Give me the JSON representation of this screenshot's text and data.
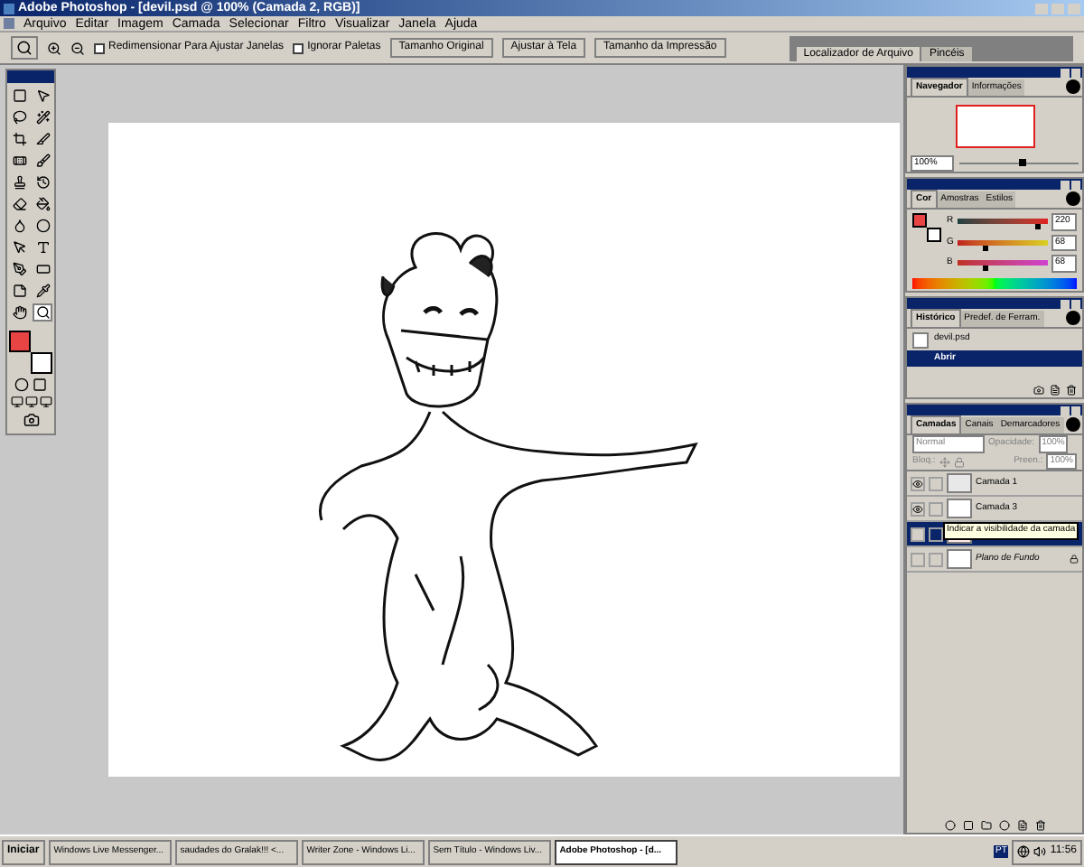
{
  "window": {
    "title": "Adobe Photoshop - [devil.psd @ 100% (Camada 2, RGB)]"
  },
  "menu": [
    "Arquivo",
    "Editar",
    "Imagem",
    "Camada",
    "Selecionar",
    "Filtro",
    "Visualizar",
    "Janela",
    "Ajuda"
  ],
  "options_bar": {
    "checkboxes": [
      {
        "label": "Redimensionar Para Ajustar Janelas",
        "checked": false
      },
      {
        "label": "Ignorar Paletas",
        "checked": false
      }
    ],
    "buttons": [
      "Tamanho Original",
      "Ajustar à Tela",
      "Tamanho da Impressão"
    ],
    "palette_well_tabs": [
      {
        "label": "Localizador de Arquivo",
        "selected": true
      },
      {
        "label": "Pincéis",
        "selected": false
      }
    ]
  },
  "toolbox": {
    "tools": [
      {
        "kind": "marquee",
        "selected": false
      },
      {
        "kind": "move",
        "selected": false
      },
      {
        "kind": "lasso",
        "selected": false
      },
      {
        "kind": "wand",
        "selected": false
      },
      {
        "kind": "crop",
        "selected": false
      },
      {
        "kind": "slice",
        "selected": false
      },
      {
        "kind": "heal",
        "selected": false
      },
      {
        "kind": "brush",
        "selected": false
      },
      {
        "kind": "stamp",
        "selected": false
      },
      {
        "kind": "history",
        "selected": false
      },
      {
        "kind": "eraser",
        "selected": false
      },
      {
        "kind": "bucket",
        "selected": false
      },
      {
        "kind": "blur",
        "selected": false
      },
      {
        "kind": "dodge",
        "selected": false
      },
      {
        "kind": "select",
        "selected": false
      },
      {
        "kind": "text",
        "selected": false
      },
      {
        "kind": "pen",
        "selected": false
      },
      {
        "kind": "shape",
        "selected": false
      },
      {
        "kind": "notes",
        "selected": false
      },
      {
        "kind": "eyedropper",
        "selected": false
      },
      {
        "kind": "hand",
        "selected": false
      },
      {
        "kind": "zoom",
        "selected": true
      }
    ],
    "swatches": [
      {
        "kind": "background",
        "color": "#ffffff"
      },
      {
        "kind": "foreground",
        "color": "#e84444"
      }
    ]
  },
  "navigator": {
    "tabs": [
      {
        "label": "Navegador",
        "selected": true
      },
      {
        "label": "Informações",
        "selected": false
      }
    ],
    "zoom": "100%",
    "level": 0.5
  },
  "color_panel": {
    "tabs": [
      {
        "label": "Cor",
        "selected": true
      },
      {
        "label": "Amostras",
        "selected": false
      },
      {
        "label": "Estilos",
        "selected": false
      }
    ],
    "swatches": [
      {
        "kind": "background",
        "color": "#ffffff"
      },
      {
        "kind": "foreground",
        "color": "#e84444"
      }
    ],
    "channels": [
      {
        "label": "R",
        "value": "220",
        "level": 0.86
      },
      {
        "label": "G",
        "value": "68",
        "level": 0.27
      },
      {
        "label": "B",
        "value": "68",
        "level": 0.27
      }
    ]
  },
  "history": {
    "tabs": [
      {
        "label": "Histórico",
        "selected": true
      },
      {
        "label": "Predef. de Ferram.",
        "selected": false
      }
    ],
    "snapshot": "devil.psd",
    "steps": [
      {
        "label": "Abrir",
        "selected": true
      }
    ]
  },
  "layers_panel": {
    "tabs": [
      {
        "label": "Camadas",
        "selected": true
      },
      {
        "label": "Canais",
        "selected": false
      },
      {
        "label": "Demarcadores",
        "selected": false
      }
    ],
    "blend_mode": "Normal",
    "opacity_label": "Opacidade:",
    "opacity": "100%",
    "lock_label": "Bloq.:",
    "fill_label": "Preen.:",
    "fill": "100%",
    "layers": [
      {
        "name": "Camada 1",
        "visible": true,
        "selected": false,
        "kind": "transparent"
      },
      {
        "name": "Camada 3",
        "visible": true,
        "selected": false,
        "kind": "white"
      },
      {
        "visible": false,
        "selected": true,
        "kind": "sketch"
      },
      {
        "name": "Plano de Fundo",
        "visible": false,
        "selected": false,
        "kind": "background"
      }
    ],
    "tooltip": "Indicar a visibilidade da camada"
  },
  "taskbar": {
    "start": "Iniciar",
    "tasks": [
      {
        "label": "Windows Live Messenger...",
        "selected": false
      },
      {
        "label": "saudades do Gralak!!! <...",
        "selected": false
      },
      {
        "label": "Writer Zone - Windows Li...",
        "selected": false
      },
      {
        "label": "Sem Título - Windows Liv...",
        "selected": false
      },
      {
        "label": "Adobe Photoshop - [d...",
        "selected": true
      }
    ],
    "language": "PT",
    "time": "11:56"
  }
}
